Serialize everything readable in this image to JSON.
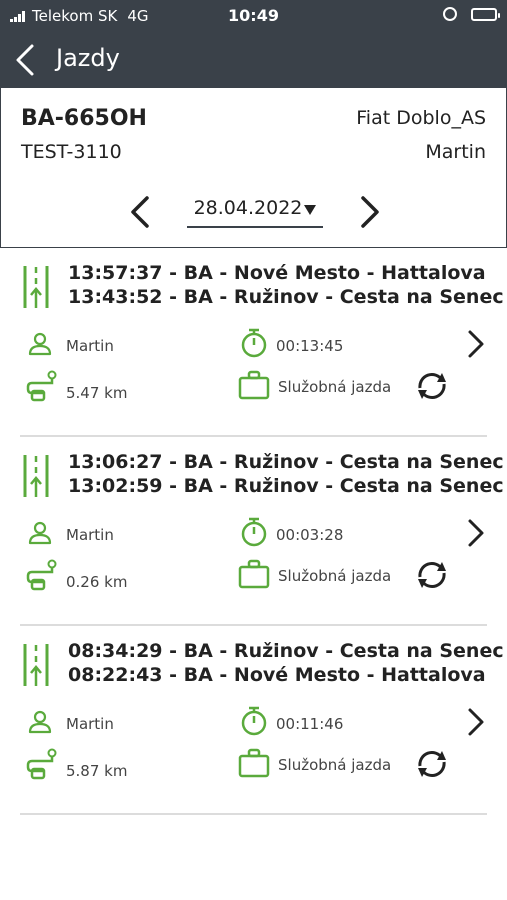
{
  "status_bar": {
    "carrier": "Telekom SK",
    "network": "4G",
    "time": "10:49"
  },
  "header": {
    "title": "Jazdy"
  },
  "vehicle": {
    "plate": "BA-665OH",
    "model": "Fiat Doblo_AS",
    "tag": "TEST-3110",
    "driver": "Martin"
  },
  "date_picker": {
    "date": "28.04.2022"
  },
  "trips": [
    {
      "end": "13:57:37 - BA - Nové Mesto - Hattalova",
      "start": "13:43:52 - BA - Ružinov - Cesta na Senec",
      "driver": "Martin",
      "duration": "00:13:45",
      "distance": "5.47 km",
      "purpose": "Služobná jazda"
    },
    {
      "end": "13:06:27 - BA - Ružinov - Cesta na Senec",
      "start": "13:02:59 - BA - Ružinov - Cesta na Senec",
      "driver": "Martin",
      "duration": "00:03:28",
      "distance": "0.26 km",
      "purpose": "Služobná jazda"
    },
    {
      "end": "08:34:29 - BA - Ružinov - Cesta na Senec",
      "start": "08:22:43 - BA - Nové Mesto - Hattalova",
      "driver": "Martin",
      "duration": "00:11:46",
      "distance": "5.87 km",
      "purpose": "Služobná jazda"
    }
  ],
  "icons": {
    "route": "route-icon",
    "driver": "person-icon",
    "duration": "timer-icon",
    "distance": "distance-icon",
    "purpose": "briefcase-icon",
    "sync": "sync-icon",
    "open": "chevron-right-icon"
  },
  "colors": {
    "header_bg": "#3a4149",
    "accent_green": "#5aaa3c",
    "divider": "#dcdcdc"
  }
}
